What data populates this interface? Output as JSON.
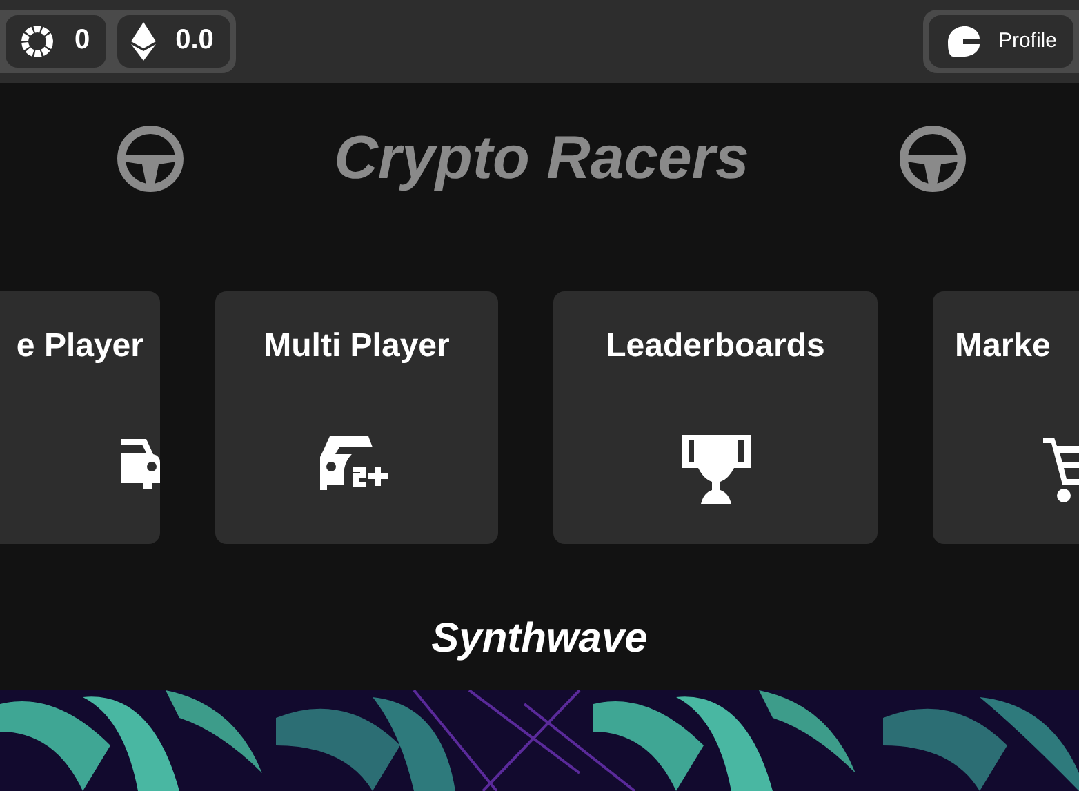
{
  "top_bar": {
    "balances": [
      {
        "kind": "token",
        "value": "0"
      },
      {
        "kind": "eth",
        "value": "0.0"
      }
    ],
    "profile_button": {
      "label": "Profile"
    }
  },
  "title": "Crypto Racers",
  "modes": [
    {
      "label": "e Player",
      "kind": "car"
    },
    {
      "label": "Multi Player",
      "kind": "multi"
    },
    {
      "label": "Leaderboards",
      "kind": "trophy"
    },
    {
      "label": "Marke",
      "kind": "cart"
    }
  ],
  "theme": {
    "label": "Synthwave",
    "kind": "picture"
  }
}
